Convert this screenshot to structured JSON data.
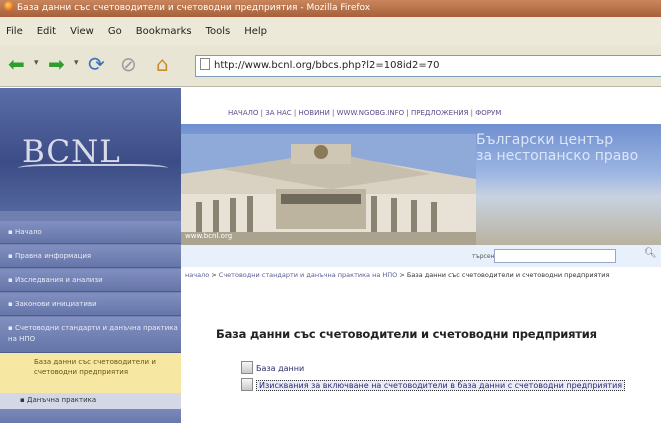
{
  "window": {
    "title": "База данни със счетоводители и счетоводни предприятия - Mozilla Firefox"
  },
  "menu": {
    "items": [
      "File",
      "Edit",
      "View",
      "Go",
      "Bookmarks",
      "Tools",
      "Help"
    ]
  },
  "toolbar": {
    "back_icon": "back-arrow-icon",
    "forward_icon": "forward-arrow-icon",
    "reload_icon": "reload-icon",
    "stop_icon": "stop-icon",
    "home_icon": "home-icon",
    "url": "http://www.bcnl.org/bbcs.php?l2=108id2=70"
  },
  "site": {
    "logo": "BCNL",
    "sidebar": {
      "items": [
        "Начало",
        "Правна информация",
        "Изследвания и анализи",
        "Законови инициативи",
        "Счетоводни стандарти и данъчна практика на НПО"
      ],
      "sub_active": "База данни със счетоводители и счетоводни предприятия",
      "sub_item": "Данъчна практика"
    },
    "topnav": [
      "НАЧАЛО",
      "ЗА НАС",
      "НОВИНИ",
      "WWW.NGOBG.INFO",
      "ПРЕДЛОЖЕНИЯ",
      "ФОРУМ"
    ],
    "banner": {
      "line1": "Български център",
      "line2": "за нестопанско право",
      "url": "www.bcnl.org"
    },
    "search_label": "търсене",
    "breadcrumb": {
      "home": "начало",
      "section": "Счетоводни стандарти и данъчна практика на НПО",
      "current": "База данни със счетоводители и счетоводни предприятия"
    },
    "page_title": "База данни със счетоводители и счетоводни предприятия",
    "links": [
      "База данни",
      "Изисквания за включване на счетоводители в база данни с счетоводни предприятия"
    ]
  }
}
